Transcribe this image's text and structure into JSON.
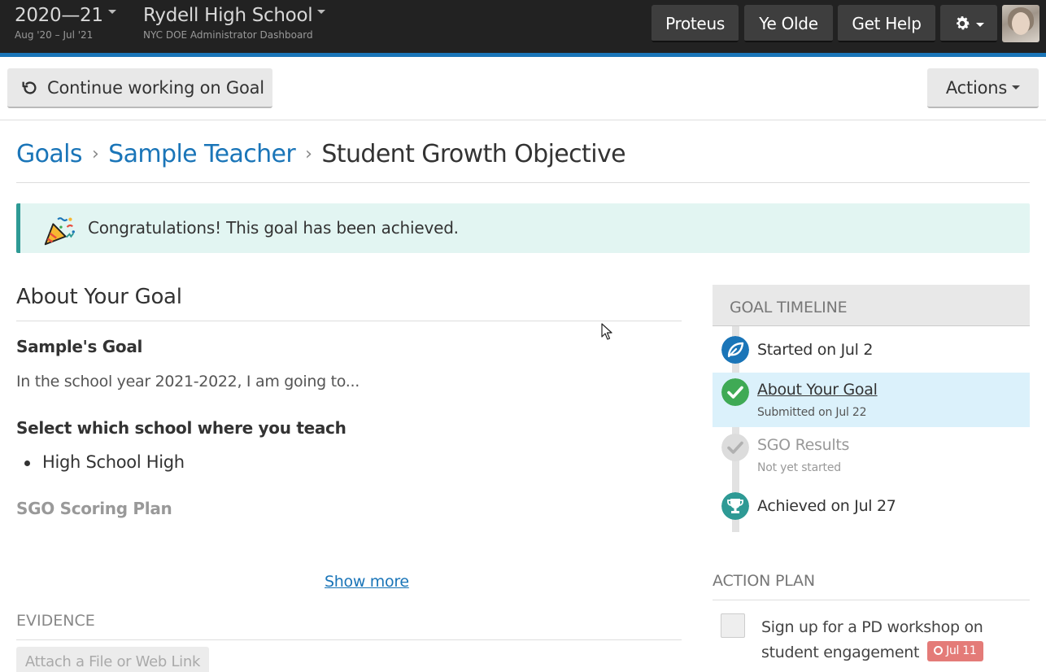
{
  "topbar": {
    "year": "2020—21",
    "year_range": "Aug '20 – Jul '21",
    "school": "Rydell High School",
    "school_sub": "NYC DOE Administrator Dashboard",
    "buttons": [
      "Proteus",
      "Ye Olde",
      "Get Help"
    ],
    "gear_icon": "gear-icon"
  },
  "toolbar": {
    "continue_label": "Continue working on Goal",
    "actions_label": "Actions"
  },
  "breadcrumb": {
    "items": [
      "Goals",
      "Sample Teacher"
    ],
    "current": "Student Growth Objective"
  },
  "alert": {
    "message": "Congratulations! This goal has been achieved.",
    "icon": "party-popper-icon"
  },
  "about": {
    "heading": "About Your Goal",
    "goal_heading": "Sample's Goal",
    "goal_text": "In the school year 2021-2022, I am going to...",
    "school_heading": "Select which school where you teach",
    "school_value": "High School High",
    "scoring_heading": "SGO Scoring Plan",
    "show_more": "Show more"
  },
  "evidence": {
    "heading": "EVIDENCE",
    "attach_label": "Attach a File or Web Link"
  },
  "timeline": {
    "heading": "GOAL TIMELINE",
    "items": [
      {
        "label": "Started on Jul 2",
        "sub": "",
        "icon": "leaf-icon",
        "color": "#1a75b8"
      },
      {
        "label": "About Your Goal",
        "sub": "Submitted on Jul 22",
        "icon": "check-icon",
        "color": "#3faa55"
      },
      {
        "label": "SGO Results",
        "sub": "Not yet started",
        "icon": "check-icon",
        "color": "#cccccc"
      },
      {
        "label": "Achieved on Jul 27",
        "sub": "",
        "icon": "trophy-icon",
        "color": "#2e9a95"
      }
    ]
  },
  "action_plan": {
    "heading": "ACTION PLAN",
    "task": "Sign up for a PD workshop on student engagement",
    "due": "Jul 11",
    "due_color": "#e47b78"
  },
  "colors": {
    "brand_blue": "#1a75b8",
    "topbar": "#222222",
    "success_bg": "#e2f5f2"
  }
}
